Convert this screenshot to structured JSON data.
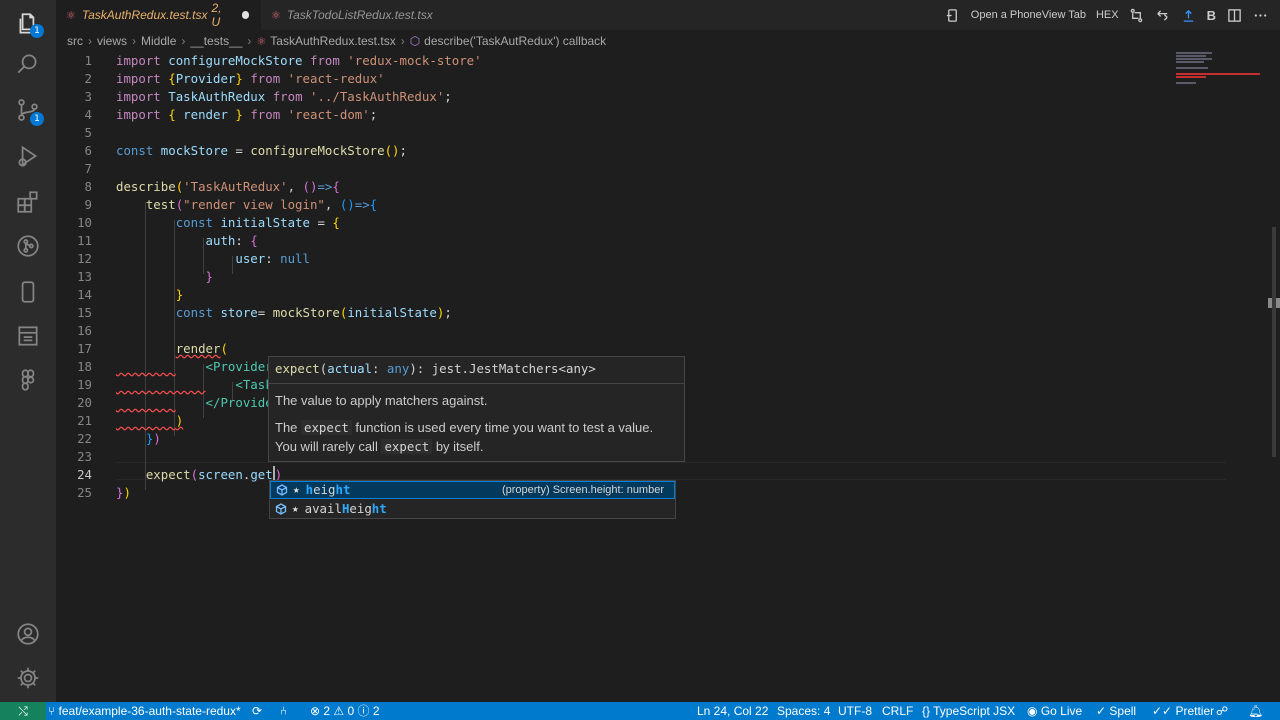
{
  "tabs": [
    {
      "icon": "react-icon",
      "label": "TaskAuthRedux.test.tsx",
      "status": "2, U",
      "active": true
    },
    {
      "icon": "react-icon",
      "label": "TaskTodoListRedux.test.tsx",
      "active": false
    }
  ],
  "tab_actions": {
    "phoneview_label": "Open a PhoneView Tab",
    "hex_label": "HEX",
    "b_label": "B"
  },
  "breadcrumb": {
    "src": "src",
    "views": "views",
    "middle": "Middle",
    "tests": "__tests__",
    "file": "TaskAuthRedux.test.tsx",
    "symbol": "describe('TaskAutRedux') callback"
  },
  "editor": {
    "line_numbers": [
      "1",
      "2",
      "3",
      "4",
      "5",
      "6",
      "7",
      "8",
      "9",
      "10",
      "11",
      "12",
      "13",
      "14",
      "15",
      "16",
      "17",
      "18",
      "19",
      "20",
      "21",
      "22",
      "23",
      "24",
      "25"
    ],
    "current_line": "24"
  },
  "code": {
    "l1": {
      "kw": "import",
      "name": "configureMockStore",
      "from": "from",
      "str": "'redux-mock-store'"
    },
    "l2": {
      "kw": "import",
      "name": "Provider",
      "from": "from",
      "str": "'react-redux'"
    },
    "l3": {
      "kw": "import",
      "name": "TaskAuthRedux",
      "from": "from",
      "str": "'../TaskAuthRedux'"
    },
    "l4": {
      "kw": "import",
      "name": "render",
      "from": "from",
      "str": "'react-dom'"
    },
    "l6": {
      "kw": "const",
      "name": "mockStore",
      "fn": "configureMockStore"
    },
    "l8": {
      "fn": "describe",
      "str": "'TaskAutRedux'"
    },
    "l9": {
      "fn": "test",
      "str": "\"render view login\""
    },
    "l10": {
      "kw": "const",
      "name": "initialState"
    },
    "l11": {
      "name": "auth"
    },
    "l12": {
      "name": "user",
      "val": "null"
    },
    "l15": {
      "kw": "const",
      "name": "store",
      "fn": "mockStore",
      "arg": "initialState"
    },
    "l17": {
      "fn": "render"
    },
    "l18": {
      "tag": "<Provider"
    },
    "l19": {
      "tag": "<Task"
    },
    "l20": {
      "tag": "</Provide"
    },
    "l24": {
      "fn": "expect",
      "obj": "screen",
      "prop": "get"
    }
  },
  "hover": {
    "fn": "expect",
    "param": "actual",
    "type": "any",
    "ret": "jest.JestMatchers<any>",
    "desc": "The value to apply matchers against.",
    "p2_a": "The ",
    "p2_code1": "expect",
    "p2_b": " function is used every time you want to test a value.",
    "p2_c": "You will rarely call ",
    "p2_code2": "expect",
    "p2_d": " by itself."
  },
  "suggest": [
    {
      "pre": "",
      "match": "h",
      "post": "eig",
      "match2": "ht",
      "label": "height",
      "detail": "(property) Screen.height: number",
      "selected": true
    },
    {
      "pre": "avail",
      "match": "H",
      "post": "eig",
      "match2": "ht",
      "label": "availHeight",
      "detail": "",
      "selected": false
    }
  ],
  "statusbar": {
    "branch": "feat/example-36-auth-state-redux*",
    "errors": "2",
    "warnings": "0",
    "infos": "2",
    "position": "Ln 24, Col 22",
    "spaces": "Spaces: 4",
    "encoding": "UTF-8",
    "eol": "CRLF",
    "language": "TypeScript JSX",
    "golive": "Go Live",
    "spell": "Spell",
    "prettier": "Prettier"
  },
  "activity_badges": {
    "explorer": "1",
    "scm": "1"
  },
  "colors": {
    "statusbar": "#007acc",
    "remote": "#16825d",
    "error": "#f14c4c",
    "tab_modified": "#e8b16b"
  }
}
